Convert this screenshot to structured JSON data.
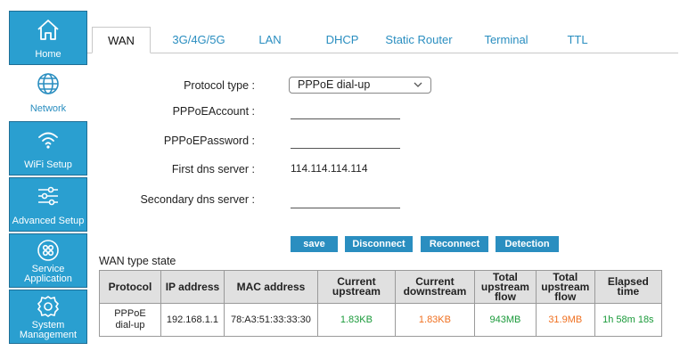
{
  "sidebar": {
    "items": [
      {
        "label": "Home",
        "icon": "home-icon"
      },
      {
        "label": "Network",
        "icon": "globe-icon"
      },
      {
        "label": "WiFi Setup",
        "icon": "wifi-icon"
      },
      {
        "label": "Advanced Setup",
        "icon": "sliders-icon"
      },
      {
        "label": "Service Application",
        "line1": "Service",
        "line2": "Application",
        "icon": "apps-icon"
      },
      {
        "label": "System Management",
        "line1": "System",
        "line2": "Management",
        "icon": "gear-icon"
      }
    ]
  },
  "tabs": [
    {
      "label": "WAN"
    },
    {
      "label": "3G/4G/5G"
    },
    {
      "label": "LAN"
    },
    {
      "label": "DHCP"
    },
    {
      "label": "Static Router"
    },
    {
      "label": "Terminal"
    },
    {
      "label": "TTL"
    }
  ],
  "form": {
    "protocol_label": "Protocol type :",
    "protocol_value": "PPPoE dial-up",
    "account_label": "PPPoEAccount :",
    "account_value": "",
    "password_label": "PPPoEPassword :",
    "password_value": "",
    "first_dns_label": "First dns server :",
    "first_dns_value": "114.114.114.114",
    "second_dns_label": "Secondary dns server :",
    "second_dns_value": ""
  },
  "buttons": {
    "save": "save",
    "disconnect": "Disconnect",
    "reconnect": "Reconnect",
    "detection": "Detection"
  },
  "state": {
    "title": "WAN type state",
    "headers": {
      "protocol": "Protocol",
      "ip": "IP address",
      "mac": "MAC address",
      "cur_up_1": "Current",
      "cur_up_2": "upstream",
      "cur_down_1": "Current",
      "cur_down_2": "downstream",
      "tot_up_1": "Total",
      "tot_up_2": "upstream",
      "tot_up_3": "flow",
      "tot_up2_1": "Total",
      "tot_up2_2": "upstream",
      "tot_up2_3": "flow",
      "elapsed": "Elapsed time"
    },
    "row": {
      "protocol_1": "PPPoE",
      "protocol_2": "dial-up",
      "ip": "192.168.1.1",
      "mac": "78:A3:51:33:33:30",
      "current_upstream": "1.83KB",
      "current_downstream": "1.83KB",
      "total_upstream_flow": "943MB",
      "total_upstream_flow_2": "31.9MB",
      "elapsed_time": "1h 58m 18s"
    }
  },
  "colors": {
    "accent": "#2a9fd0",
    "button": "#2a8ec0",
    "green_value": "#1a9a3a",
    "orange_value": "#f07020"
  }
}
